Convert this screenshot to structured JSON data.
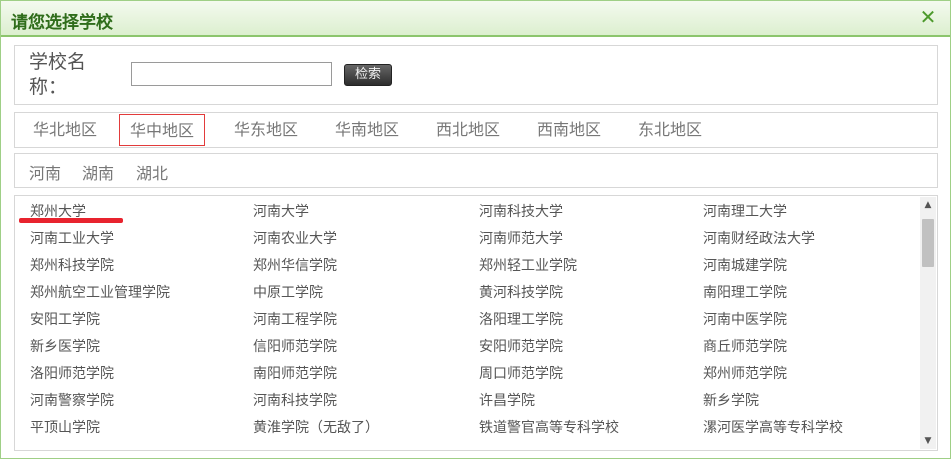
{
  "dialog": {
    "title": "请您选择学校",
    "close_label": "✕"
  },
  "search": {
    "label": "学校名称：",
    "value": "",
    "button_label": "检索"
  },
  "regions": [
    "华北地区",
    "华中地区",
    "华东地区",
    "华南地区",
    "西北地区",
    "西南地区",
    "东北地区"
  ],
  "active_region": "华中地区",
  "provinces": [
    "河南",
    "湖南",
    "湖北"
  ],
  "schools": [
    [
      "郑州大学",
      "河南大学",
      "河南科技大学",
      "河南理工大学"
    ],
    [
      "河南工业大学",
      "河南农业大学",
      "河南师范大学",
      "河南财经政法大学"
    ],
    [
      "郑州科技学院",
      "郑州华信学院",
      "郑州轻工业学院",
      "河南城建学院"
    ],
    [
      "郑州航空工业管理学院",
      "中原工学院",
      "黄河科技学院",
      "南阳理工学院"
    ],
    [
      "安阳工学院",
      "河南工程学院",
      "洛阳理工学院",
      "河南中医学院"
    ],
    [
      "新乡医学院",
      "信阳师范学院",
      "安阳师范学院",
      "商丘师范学院"
    ],
    [
      "洛阳师范学院",
      "南阳师范学院",
      "周口师范学院",
      "郑州师范学院"
    ],
    [
      "河南警察学院",
      "河南科技学院",
      "许昌学院",
      "新乡学院"
    ],
    [
      "平顶山学院",
      "黄淮学院（无敌了）",
      "铁道警官高等专科学校",
      "漯河医学高等专科学校"
    ]
  ],
  "icons": {
    "scroll_up": "▲",
    "scroll_down": "▼"
  },
  "colors": {
    "title_text": "#2f6d1b",
    "active_border": "#e23b3b",
    "underline": "#e8232e"
  }
}
